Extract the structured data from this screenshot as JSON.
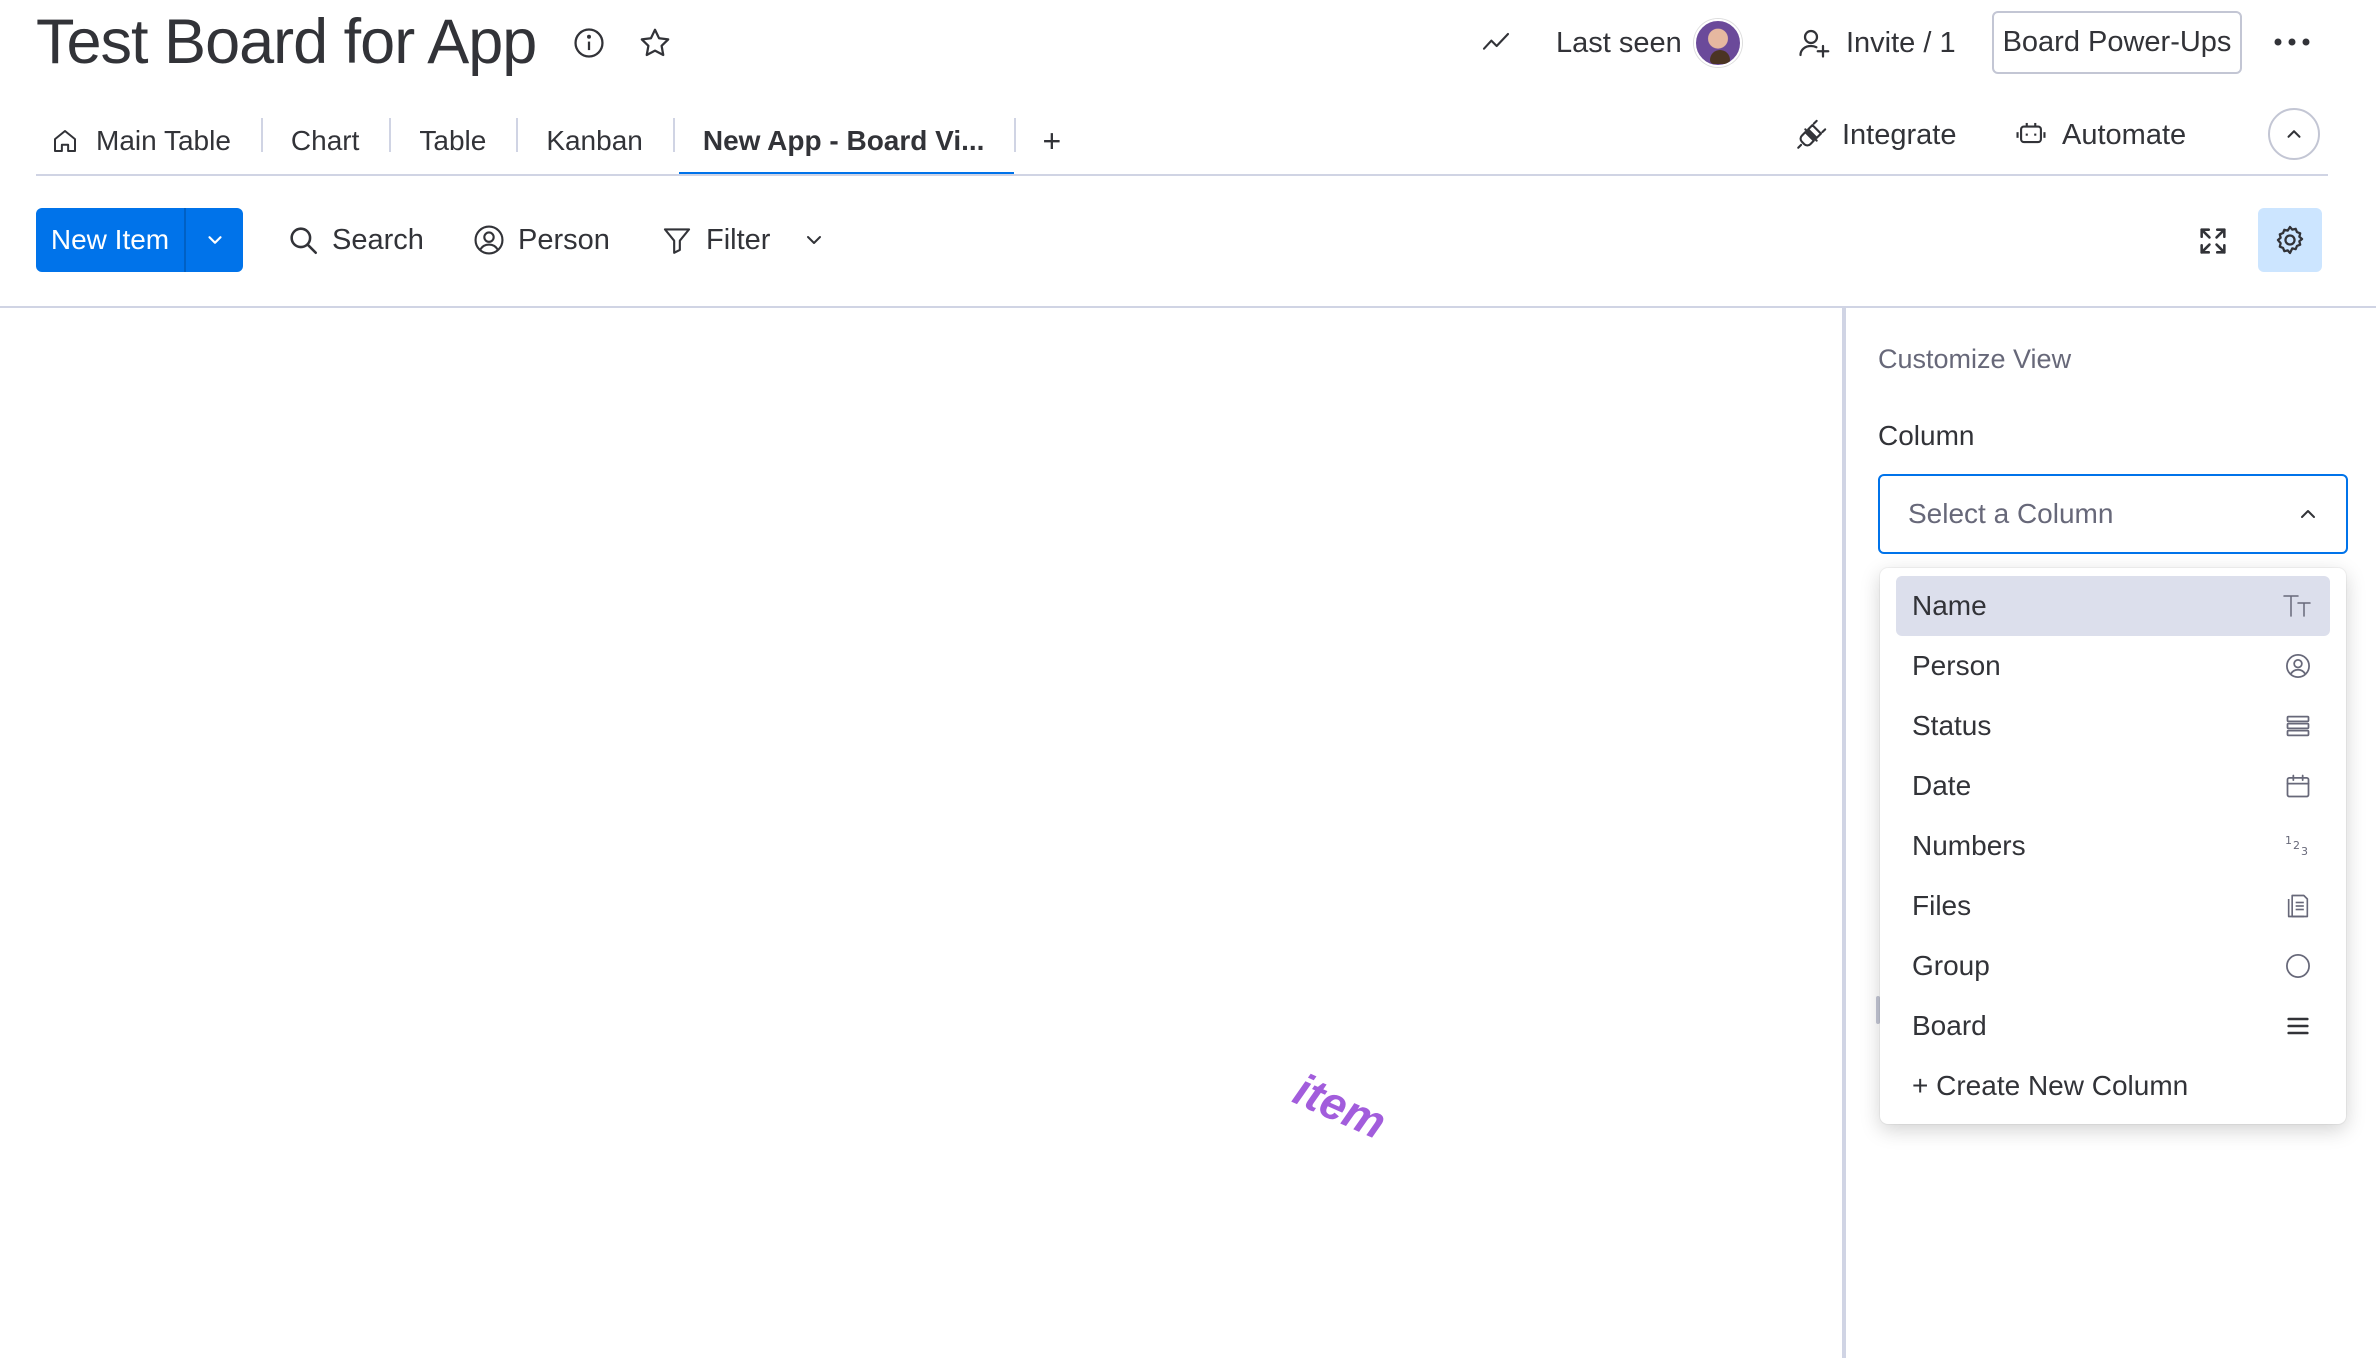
{
  "board": {
    "title": "Test Board for App"
  },
  "header": {
    "last_seen_label": "Last seen",
    "invite_label": "Invite / 1",
    "powerups_label": "Board Power-Ups"
  },
  "tabs": [
    {
      "label": "Main Table",
      "icon": "home-icon"
    },
    {
      "label": "Chart"
    },
    {
      "label": "Table"
    },
    {
      "label": "Kanban"
    },
    {
      "label": "New App - Board Vi...",
      "active": true
    }
  ],
  "tab_add_label": "+",
  "integrations": {
    "integrate_label": "Integrate",
    "automate_label": "Automate"
  },
  "toolbar": {
    "new_item_label": "New Item",
    "search_label": "Search",
    "person_label": "Person",
    "filter_label": "Filter"
  },
  "canvas": {
    "floating_word": "item"
  },
  "panel": {
    "title": "Customize View",
    "column_label": "Column",
    "select_placeholder": "Select a Column",
    "options": [
      {
        "label": "Name",
        "icon": "text-type-icon",
        "selected": true
      },
      {
        "label": "Person",
        "icon": "person-circle-icon"
      },
      {
        "label": "Status",
        "icon": "status-lines-icon"
      },
      {
        "label": "Date",
        "icon": "calendar-icon"
      },
      {
        "label": "Numbers",
        "icon": "numbers-icon"
      },
      {
        "label": "Files",
        "icon": "files-icon"
      },
      {
        "label": "Group",
        "icon": "circle-icon"
      },
      {
        "label": "Board",
        "icon": "menu-lines-icon"
      }
    ],
    "create_label": "+ Create New Column"
  },
  "colors": {
    "primary": "#0073ea",
    "text": "#323338",
    "muted": "#676879",
    "border": "#d0d4e4",
    "selected_bg": "#dcdfec",
    "floating_word": "#a25ddc",
    "settings_bg": "#cce5ff"
  }
}
